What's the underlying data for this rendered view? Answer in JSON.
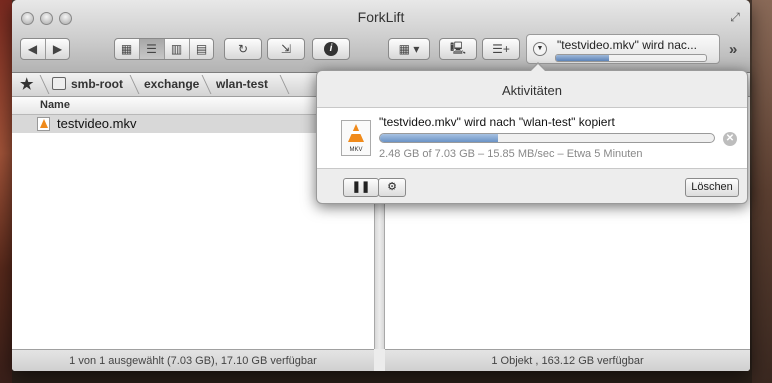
{
  "window": {
    "title": "ForkLift"
  },
  "toolbar": {
    "back_icon": "chevron-left-icon",
    "forward_icon": "chevron-right-icon",
    "view_modes": [
      "icon-view",
      "list-view",
      "column-view",
      "coverflow-view"
    ],
    "active_view": "list-view",
    "refresh_icon": "refresh-icon",
    "sync_icon": "sync-icon",
    "info_icon": "info-icon",
    "more_label": "»"
  },
  "activity_mini": {
    "text": "\"testvideo.mkv\" wird nac...",
    "progress": 0.353
  },
  "breadcrumb": {
    "items": [
      "smb-root",
      "exchange",
      "wlan-test"
    ]
  },
  "left_pane": {
    "column_header": "Name",
    "files": [
      {
        "name": "testvideo.mkv",
        "selected": true
      }
    ],
    "status": "1 von 1 ausgewählt  (7.03 GB), 17.10 GB verfügbar"
  },
  "right_pane": {
    "status": "1 Objekt , 163.12 GB verfügbar"
  },
  "activities_popover": {
    "title": "Aktivitäten",
    "job": {
      "title": "\"testvideo.mkv\" wird nach \"wlan-test\" kopiert",
      "file_ext": "MKV",
      "status": "2.48 GB of 7.03 GB – 15.85 MB/sec – Etwa 5 Minuten",
      "progress": 0.353
    },
    "clear_label": "Löschen"
  },
  "colors": {
    "progress_fill": "#6b93c6",
    "selection": "#d8d8d8"
  }
}
